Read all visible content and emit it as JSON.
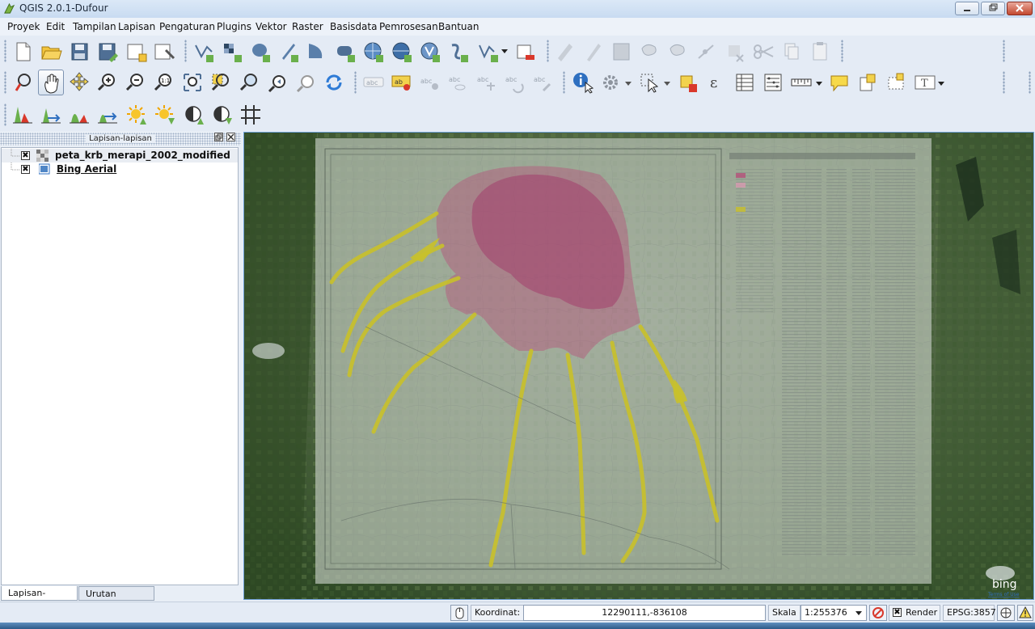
{
  "window": {
    "title": "QGIS 2.0.1-Dufour"
  },
  "menu": [
    "Proyek",
    "Edit",
    "Tampilan",
    "Lapisan",
    "Pengaturan",
    "Plugins",
    "Vektor",
    "Raster",
    "Basisdata",
    "Pemrosesan",
    "Bantuan"
  ],
  "toolbar": {
    "row1": [
      "new-project-icon",
      "open-project-icon",
      "save-project-icon",
      "save-as-icon",
      "new-print-composer-icon",
      "composer-manager-icon",
      "add-vector-layer-icon",
      "add-raster-layer-icon",
      "add-postgis-layer-icon",
      "add-spatialite-layer-icon",
      "add-mssql-layer-icon",
      "add-oracle-layer-icon",
      "add-wms-layer-icon",
      "add-wcs-layer-icon",
      "add-wfs-layer-icon",
      "add-delimited-text-icon",
      "new-shapefile-icon",
      "remove-layer-icon",
      "current-edits-icon",
      "toggle-editing-icon",
      "save-edits-icon",
      "add-feature-icon",
      "move-feature-icon",
      "node-tool-icon",
      "delete-selected-icon",
      "cut-features-icon",
      "copy-features-icon",
      "paste-features-icon"
    ],
    "row2": [
      "touch-zoom-icon",
      "pan-icon",
      "pan-to-selection-icon",
      "zoom-in-icon",
      "zoom-out-icon",
      "zoom-actual-size-icon",
      "zoom-full-icon",
      "zoom-to-selection-icon",
      "zoom-to-layer-icon",
      "zoom-last-icon",
      "zoom-next-icon",
      "refresh-icon",
      "label-icon",
      "layer-labeling-icon",
      "pin-labels-icon",
      "show-hide-labels-icon",
      "move-label-icon",
      "rotate-label-icon",
      "change-label-icon",
      "identify-icon",
      "run-action-icon",
      "select-features-icon",
      "deselect-all-icon",
      "field-calculator-icon",
      "open-attribute-table-icon",
      "statistical-summary-icon",
      "measure-line-icon",
      "map-tips-icon",
      "new-bookmark-icon",
      "show-bookmarks-icon",
      "text-annotation-icon"
    ],
    "row3": [
      "histogram-stretch-icon",
      "local-histogram-stretch-icon",
      "cumulative-cut-stretch-icon",
      "local-cumulative-stretch-icon",
      "increase-brightness-icon",
      "decrease-brightness-icon",
      "increase-contrast-icon",
      "decrease-contrast-icon",
      "coordinate-capture-icon"
    ]
  },
  "layers_panel": {
    "title": "Lapisan-lapisan",
    "layers": [
      {
        "name": "peta_krb_merapi_2002_modified",
        "checked": "✖",
        "icon": "raster-layer-icon"
      },
      {
        "name": "Bing Aerial",
        "checked": "✖",
        "icon": "wms-layer-icon"
      }
    ],
    "tabs": [
      "Lapisan-lapisan",
      "Urutan Lapisan"
    ]
  },
  "map": {
    "watermark": "bing",
    "terms": "Terms of Use"
  },
  "status": {
    "coord_label": "Koordinat:",
    "coord_value": "12290111,-836108",
    "scale_label": "Skala",
    "scale_value": "1:255376",
    "render_label": "Render",
    "render_checked": "✖",
    "crs": "EPSG:3857"
  },
  "colors": {
    "accent": "#6ea0d6",
    "hazard_zone": "#b5517a",
    "lahar_channel": "#c9c12a"
  }
}
